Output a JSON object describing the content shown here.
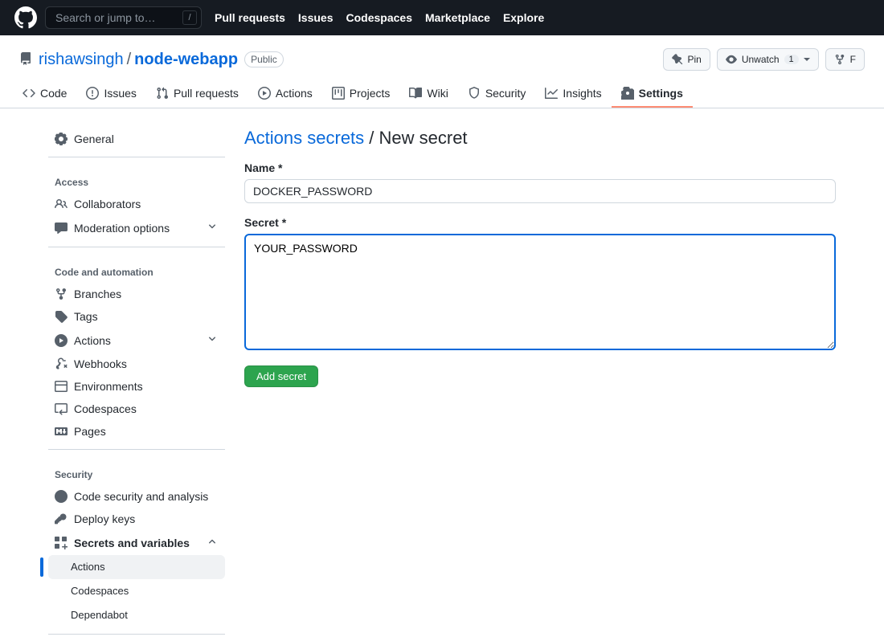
{
  "header": {
    "search_placeholder": "Search or jump to…",
    "search_key": "/",
    "nav": [
      "Pull requests",
      "Issues",
      "Codespaces",
      "Marketplace",
      "Explore"
    ]
  },
  "repo": {
    "owner": "rishawsingh",
    "name": "node-webapp",
    "visibility": "Public",
    "pin_label": "Pin",
    "watch_label": "Unwatch",
    "watch_count": "1",
    "fork_label": "F"
  },
  "tabs": {
    "items": [
      "Code",
      "Issues",
      "Pull requests",
      "Actions",
      "Projects",
      "Wiki",
      "Security",
      "Insights",
      "Settings"
    ],
    "selected": "Settings"
  },
  "sidebar": {
    "general": "General",
    "groups": {
      "access": {
        "label": "Access",
        "items": [
          "Collaborators",
          "Moderation options"
        ]
      },
      "code": {
        "label": "Code and automation",
        "items": [
          "Branches",
          "Tags",
          "Actions",
          "Webhooks",
          "Environments",
          "Codespaces",
          "Pages"
        ]
      },
      "security": {
        "label": "Security",
        "items": [
          "Code security and analysis",
          "Deploy keys",
          "Secrets and variables"
        ],
        "sub": [
          "Actions",
          "Codespaces",
          "Dependabot"
        ],
        "sub_active": "Actions"
      }
    }
  },
  "page": {
    "breadcrumb_link": "Actions secrets",
    "breadcrumb_sep": " / ",
    "breadcrumb_current": "New secret",
    "name_label": "Name *",
    "name_value": "DOCKER_PASSWORD",
    "secret_label": "Secret *",
    "secret_value": "YOUR_PASSWORD",
    "submit_label": "Add secret"
  }
}
